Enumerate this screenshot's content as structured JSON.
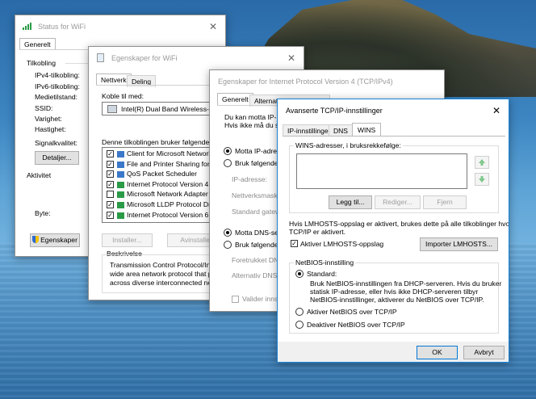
{
  "status_window": {
    "title": "Status for WiFi",
    "tab": "Generelt",
    "section_connection": "Tilkobling",
    "labels": [
      "IPv4-tilkobling:",
      "IPv6-tilkobling:",
      "Medietilstand:",
      "SSID:",
      "Varighet:",
      "Hastighet:"
    ],
    "signal_label": "Signalkvalitet:",
    "details_button": "Detaljer...",
    "section_activity": "Aktivitet",
    "bytes_label": "Byte:",
    "properties_button": "Egenskaper"
  },
  "props_window": {
    "title": "Egenskaper for WiFi",
    "tabs": [
      "Nettverk",
      "Deling"
    ],
    "connect_using_label": "Koble til med:",
    "adapter_name": "Intel(R) Dual Band Wireless-AC 7",
    "items_label": "Denne tilkoblingen bruker følgende elem",
    "items": [
      {
        "label": "Client for Microsoft Networks",
        "checked": true,
        "icon_color": "#3b78c9"
      },
      {
        "label": "File and Printer Sharing for Micr",
        "checked": true,
        "icon_color": "#3b78c9"
      },
      {
        "label": "QoS Packet Scheduler",
        "checked": true,
        "icon_color": "#3b78c9"
      },
      {
        "label": "Internet Protocol Version 4 (TC",
        "checked": true,
        "icon_color": "#2a9a46"
      },
      {
        "label": "Microsoft Network Adapter Mul",
        "checked": false,
        "icon_color": "#2a9a46"
      },
      {
        "label": "Microsoft LLDP Protocol Driver",
        "checked": true,
        "icon_color": "#2a9a46"
      },
      {
        "label": "Internet Protocol Version 6 (TC",
        "checked": true,
        "icon_color": "#2a9a46"
      }
    ],
    "install_button": "Installer...",
    "uninstall_button": "Avinstaller",
    "description_label": "Beskrivelse",
    "description_lines": [
      "Transmission Control Protocol/Interne",
      "wide area network protocol that provi",
      "across diverse interconnected networ"
    ]
  },
  "ipv4_window": {
    "title": "Egenskaper for Internet Protocol Version 4 (TCP/IPv4)",
    "tabs": [
      "Generelt",
      "Alternativ konfigurasjon"
    ],
    "intro_lines": [
      "Du kan motta IP-inn",
      "Hvis ikke må du spø"
    ],
    "auto_ip": "Motta IP-adre",
    "use_ip": "Bruk følgende",
    "ip_label": "IP-adresse:",
    "mask_label": "Nettverksmaske",
    "gateway_label": "Standard gatew",
    "auto_dns": "Motta DNS-ser",
    "use_dns": "Bruk følgende",
    "preferred_dns": "Foretrukket DNS",
    "alternate_dns": "Alternativ DNS-",
    "validate": "Valider innsti"
  },
  "adv_window": {
    "title": "Avanserte TCP/IP-innstillinger",
    "tabs": [
      "IP-innstillinger",
      "DNS",
      "WINS"
    ],
    "wins_group_label": "WINS-adresser, i bruksrekkefølge:",
    "add_button": "Legg til...",
    "edit_button": "Rediger...",
    "remove_button": "Fjern",
    "lmhosts_text_1": "Hvis LMHOSTS-oppslag er aktivert, brukes dette på alle tilkoblinger hvor",
    "lmhosts_text_2": "TCP/IP er aktivert.",
    "enable_lmhosts": "Aktiver LMHOSTS-oppslag",
    "import_button": "Importer LMHOSTS...",
    "netbios_group": "NetBIOS-innstilling",
    "opt_default": "Standard:",
    "default_desc_1": "Bruk NetBIOS-innstillingen fra DHCP-serveren. Hvis du bruker",
    "default_desc_2": "statisk IP-adresse, eller hvis ikke DHCP-serveren tilbyr",
    "default_desc_3": "NetBIOS-innstillinger, aktiverer du NetBIOS over TCP/IP.",
    "opt_enable": "Aktiver NetBIOS over TCP/IP",
    "opt_disable": "Deaktiver NetBIOS over TCP/IP",
    "ok_button": "OK",
    "cancel_button": "Avbryt"
  }
}
